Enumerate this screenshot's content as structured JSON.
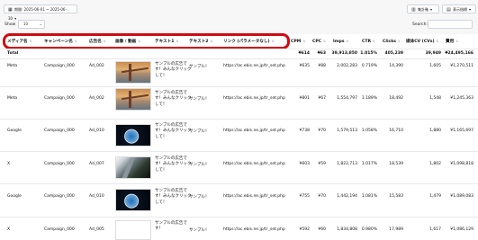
{
  "toolbar": {
    "date_range": "期間: 2025-06-01 ~ 2025-06-30",
    "aggregation": "集計軸",
    "display_metrics": "表示指標"
  },
  "controls": {
    "show_label": "Show",
    "show_value": "10",
    "search_label": "Search:"
  },
  "table": {
    "columns": [
      "メディア名",
      "キャンペーン名",
      "広告名",
      "画像 / 動画",
      "テキスト1",
      "テキスト2",
      "リンク (パラメータなし)",
      "CPM",
      "CPC",
      "Imps",
      "CTR",
      "Clicks",
      "媒体CV (CVs)",
      "費用"
    ],
    "total": {
      "label": "Total",
      "cpm": "¥614",
      "cpc": "¥63",
      "imps": "39,913,850",
      "ctr": "1.015%",
      "clicks": "405,239",
      "media_cv": "39,949",
      "cost": "¥24,495,166"
    },
    "rows": [
      {
        "media": "Meta",
        "campaign": "Campaign_000",
        "ad": "Ad_002",
        "text1": "サンプルの広告です！みんなクリックして！",
        "text2": "サンプル！",
        "link": "https://ac.ebis.ne.jp/tr_set.php",
        "cpm": "¥635",
        "cpc": "¥88",
        "imps": "2,002,283",
        "ctr": "0.719%",
        "clicks": "14,390",
        "media_cv": "1,605",
        "cost": "¥1,270,511"
      },
      {
        "media": "Meta",
        "campaign": "Campaign_000",
        "ad": "Ad_002",
        "text1": "サンプルの広告です！みんなクリックして！",
        "text2": "サンプル！",
        "link": "https://ac.ebis.ne.jp/tr_set.php",
        "cpm": "¥801",
        "cpc": "¥67",
        "imps": "1,554,797",
        "ctr": "1.189%",
        "clicks": "18,492",
        "media_cv": "1,548",
        "cost": "¥1,245,363"
      },
      {
        "media": "Google",
        "campaign": "Campaign_000",
        "ad": "Ad_010",
        "text1": "サンプルの広告です！みんなクリックして！",
        "text2": "サンプル！",
        "link": "https://ac.ebis.ne.jp/tr_set.php",
        "cpm": "¥738",
        "cpc": "¥70",
        "imps": "1,579,513",
        "ctr": "1.058%",
        "clicks": "16,710",
        "media_cv": "1,880",
        "cost": "¥1,165,697"
      },
      {
        "media": "X",
        "campaign": "Campaign_000",
        "ad": "Ad_007",
        "text1": "サンプルの広告です！みんなクリックして！",
        "text2": "サンプル！",
        "link": "https://ac.ebis.ne.jp/tr_set.php",
        "cpm": "¥603",
        "cpc": "¥59",
        "imps": "1,822,713",
        "ctr": "1.017%",
        "clicks": "18,539",
        "media_cv": "1,802",
        "cost": "¥1,098,818"
      },
      {
        "media": "Google",
        "campaign": "Campaign_000",
        "ad": "Ad_010",
        "text1": "サンプルの広告です！みんなクリックして！",
        "text2": "サンプル！",
        "link": "https://ac.ebis.ne.jp/tr_set.php",
        "cpm": "¥755",
        "cpc": "¥70",
        "imps": "1,442,194",
        "ctr": "1.081%",
        "clicks": "15,583",
        "media_cv": "1,479",
        "cost": "¥1,089,083"
      },
      {
        "media": "X",
        "campaign": "Campaign_000",
        "ad": "Ad_005",
        "text1": "サンプルの広告です！",
        "text2": "サンプル！",
        "link": "https://ac.ebis.ne.jp/tr_set.php",
        "cpm": "¥592",
        "cpc": "¥60",
        "imps": "1,834,808",
        "ctr": "0.980%",
        "clicks": "17,989",
        "media_cv": "1,617",
        "cost": "¥1,086,129"
      }
    ]
  }
}
